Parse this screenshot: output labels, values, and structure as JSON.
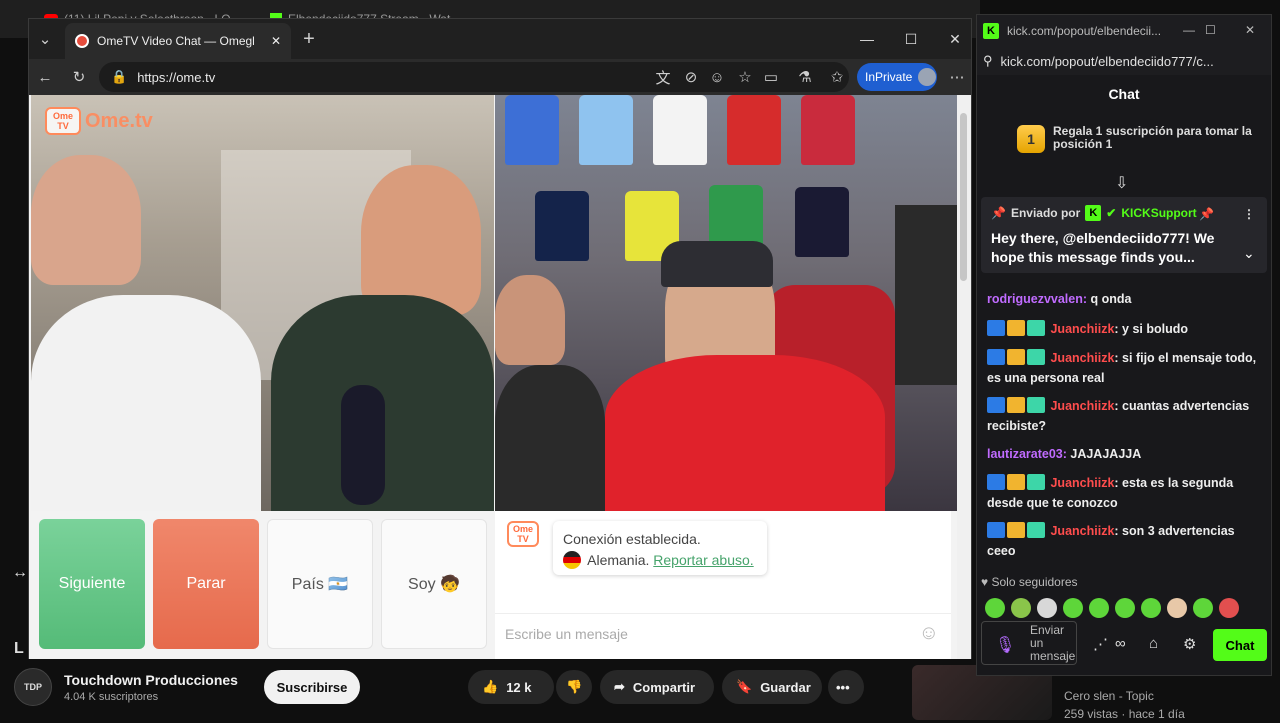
{
  "background_window": {
    "tabs": [
      {
        "label": "(11) Lil Pepi y Selectbreon - LO..."
      },
      {
        "label": "Elbendeciido777 Stream - Wat..."
      }
    ],
    "channel_name": "Touchdown Producciones",
    "channel_subs": "4.04 K suscriptores",
    "subscribe_label": "Suscribirse",
    "likes": "12 k",
    "share_label": "Compartir",
    "save_label": "Guardar",
    "more_label": "•••",
    "rec_channel": "Cero slen - Topic",
    "rec_meta": "259 vistas · hace 1 día",
    "left_letter": "L"
  },
  "browser": {
    "tab_title": "OmeTV Video Chat — Omegl",
    "url": "https://ome.tv",
    "inprivate_label": "InPrivate",
    "new_tab": "+",
    "minimize": "—",
    "maximize": "☐",
    "close": "✕"
  },
  "ometv": {
    "logo_badge": "Ome TV",
    "logo_text": "Ome.tv",
    "buttons": {
      "next": "Siguiente",
      "stop": "Parar",
      "country": "País 🇦🇷",
      "me": "Soy 🧒"
    },
    "status": {
      "line1": "Conexión establecida.",
      "country": "Alemania.",
      "report": "Reportar abuso."
    },
    "input_placeholder": "Escribe un mensaje"
  },
  "kick": {
    "window_title": "kick.com/popout/elbendecii...",
    "url": "kick.com/popout/elbendeciido777/c...",
    "header": "Chat",
    "gift_rank": "1",
    "gift_text": "Regala 1 suscripción para tomar la posición 1",
    "pinned_prefix": "Enviado por",
    "pinned_user": "KICKSupport",
    "pinned_message": "Hey there, @elbendeciido777! We hope this message finds you...",
    "messages": [
      {
        "user": "rodriguezvvalen:",
        "text": " q onda",
        "color": "purple",
        "badges": false
      },
      {
        "user": "Juanchiizk",
        "text": ": y si boludo",
        "color": "red",
        "badges": true
      },
      {
        "user": "Juanchiizk",
        "text": ": si fijo el mensaje todo, es una persona real",
        "color": "red",
        "badges": true
      },
      {
        "user": "Juanchiizk",
        "text": ": cuantas advertencias recibiste?",
        "color": "red",
        "badges": true
      },
      {
        "user": "lautizarate03:",
        "text": " JAJAJAJJA",
        "color": "purple",
        "badges": false
      },
      {
        "user": "Juanchiizk",
        "text": ": esta es la segunda desde que te conozco",
        "color": "red",
        "badges": true
      },
      {
        "user": "Juanchiizk",
        "text": ": son 3 advertencias ceeo",
        "color": "red",
        "badges": true
      }
    ],
    "followers_only": "Solo seguidores",
    "input_placeholder": "Enviar un mensaje",
    "chat_button": "Chat"
  },
  "colors": {
    "kick_green": "#53fc18",
    "ome_next": "#5cc27f",
    "ome_stop": "#e9745a",
    "inprivate_blue": "#1f5fd1"
  }
}
